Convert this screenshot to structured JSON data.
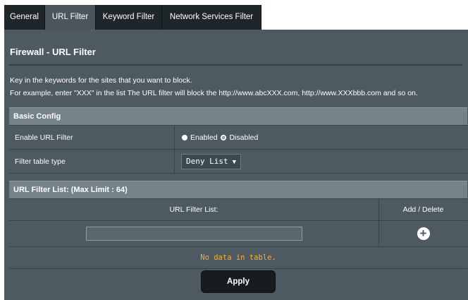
{
  "tabs": [
    {
      "label": "General"
    },
    {
      "label": "URL Filter"
    },
    {
      "label": "Keyword Filter"
    },
    {
      "label": "Network Services Filter"
    }
  ],
  "page_title": "Firewall - URL Filter",
  "description": {
    "line1": "Key in the keywords for the sites that you want to block.",
    "line2": "For example, enter \"XXX\" in the list The URL filter will block the http://www.abcXXX.com, http://www.XXXbbb.com and so on."
  },
  "basic_config": {
    "header": "Basic Config",
    "enable_label": "Enable URL Filter",
    "enabled_option": "Enabled",
    "disabled_option": "Disabled",
    "selected": "Enabled",
    "table_type_label": "Filter table type",
    "table_type_value": "Deny List"
  },
  "url_list": {
    "header": "URL Filter List: (Max Limit : 64)",
    "col_list": "URL Filter List:",
    "col_action": "Add / Delete",
    "input_value": "",
    "empty_text": "No data in table."
  },
  "apply_label": "Apply",
  "icons": {
    "add": "plus-circle-icon",
    "dropdown": "chevron-down-icon"
  },
  "colors": {
    "panel": "#4d5a61",
    "section_header": "#74838a",
    "empty_text": "#f2b233",
    "active_tab": "#4a565c",
    "tab": "#1f2629"
  }
}
